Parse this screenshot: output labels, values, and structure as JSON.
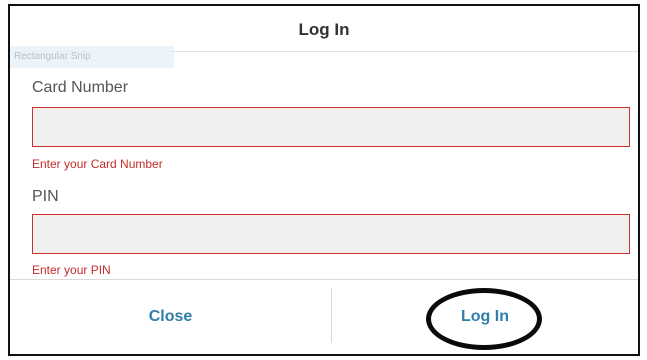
{
  "dialog": {
    "title": "Log In",
    "tooltip_text": "Rectangular Snip"
  },
  "card_number": {
    "label": "Card Number",
    "value": "",
    "placeholder": "",
    "error": "Enter your Card Number"
  },
  "pin": {
    "label": "PIN",
    "value": "",
    "placeholder": "",
    "error": "Enter your PIN"
  },
  "footer": {
    "close_label": "Close",
    "login_label": "Log In"
  },
  "colors": {
    "accent": "#2f7fab",
    "error": "#c62a2a",
    "input_border_error": "#d22f2f",
    "input_background": "#efefef",
    "annotation_ring": "#0a0a0a"
  },
  "icons": []
}
